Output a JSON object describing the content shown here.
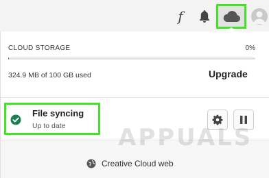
{
  "header": {
    "fonts_icon": "f",
    "icons": [
      "fonts-icon",
      "bell-icon",
      "cloud-icon",
      "avatar"
    ]
  },
  "storage": {
    "title": "CLOUD STORAGE",
    "percent_label": "0%",
    "percent_used": 0.003,
    "usage_text": "324.9 MB of 100 GB used",
    "upgrade_label": "Upgrade"
  },
  "sync": {
    "title": "File syncing",
    "status": "Up to date",
    "status_icon": "check-circle-icon"
  },
  "footer": {
    "link_label": "Creative Cloud web",
    "link_icon": "globe-icon"
  },
  "watermark": {
    "text": "APPUALS"
  },
  "colors": {
    "highlight": "#44e02a",
    "check": "#1a7f55",
    "progress": "#2d7be0"
  }
}
